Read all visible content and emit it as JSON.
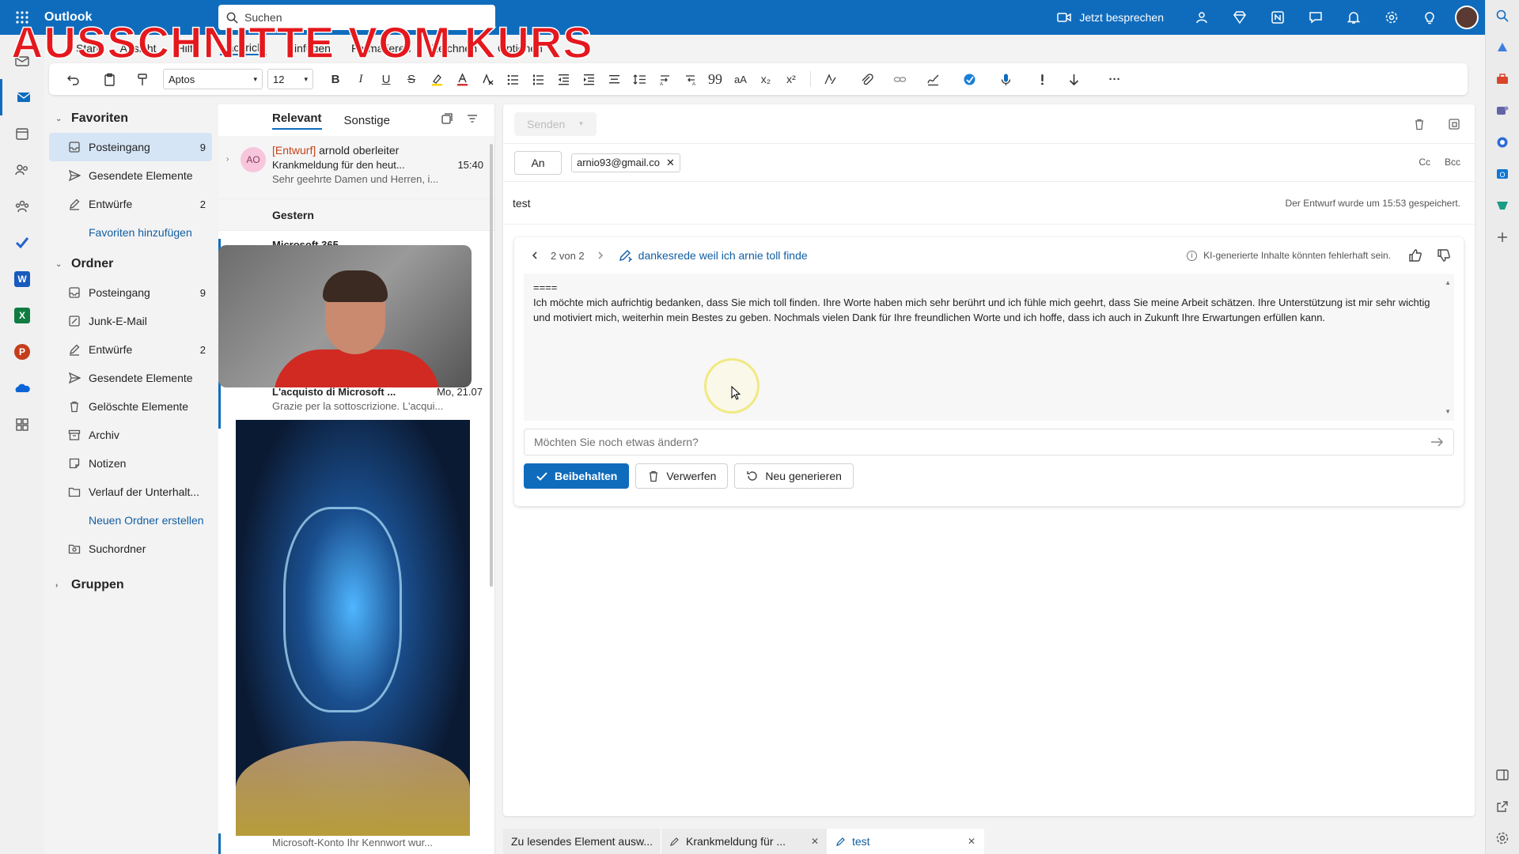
{
  "app": {
    "title": "Outlook"
  },
  "search": {
    "placeholder": "Suchen"
  },
  "topbar": {
    "meet_label": "Jetzt besprechen"
  },
  "watermark": {
    "text": "AUSSCHNITTE VOM KURS"
  },
  "ribbon": {
    "tabs": [
      "Start",
      "Ansicht",
      "Hilfe",
      "Nachricht",
      "Einfügen",
      "Formatieren",
      "Zeichnen",
      "Optionen"
    ],
    "active_tab": "Nachricht",
    "font": "Aptos",
    "font_size": "12"
  },
  "folders": {
    "favorites_label": "Favoriten",
    "favorites": [
      {
        "label": "Posteingang",
        "count": "9",
        "active": true
      },
      {
        "label": "Gesendete Elemente",
        "count": ""
      },
      {
        "label": "Entwürfe",
        "count": "2"
      }
    ],
    "add_favorite": "Favoriten hinzufügen",
    "folders_label": "Ordner",
    "folders": [
      {
        "label": "Posteingang",
        "count": "9"
      },
      {
        "label": "Junk-E-Mail",
        "count": ""
      },
      {
        "label": "Entwürfe",
        "count": "2"
      },
      {
        "label": "Gesendete Elemente",
        "count": ""
      },
      {
        "label": "Gelöschte Elemente",
        "count": ""
      },
      {
        "label": "Archiv",
        "count": ""
      },
      {
        "label": "Notizen",
        "count": ""
      },
      {
        "label": "Verlauf der Unterhalt...",
        "count": ""
      }
    ],
    "new_folder": "Neuen Ordner erstellen",
    "search_folders": "Suchordner",
    "groups_label": "Gruppen"
  },
  "message_list": {
    "tabs": [
      "Relevant",
      "Sonstige"
    ],
    "first": {
      "avatar": "AO",
      "draft_tag": "[Entwurf]",
      "sender": " arnold oberleiter",
      "subject": "Krankmeldung für den heut...",
      "time": "15:40",
      "preview": "Sehr geehrte Damen und Herren, i..."
    },
    "group_yesterday": "Gestern",
    "msft_sender": "Microsoft 365",
    "row_subject": "L'acquisto di Microsoft ...",
    "row_time": "Mo, 21.07",
    "row_preview": "Grazie per la sottoscrizione. L'acqui...",
    "last_preview": "Microsoft-Konto Ihr Kennwort wur..."
  },
  "compose": {
    "send_label": "Senden",
    "to_label": "An",
    "recipient": "arnio93@gmail.co",
    "cc": "Cc",
    "bcc": "Bcc",
    "subject": "test",
    "saved_note": "Der Entwurf wurde um 15:53 gespeichert."
  },
  "ai_card": {
    "counter": "2 von 2",
    "title": "dankesrede weil ich arnie toll finde",
    "disclaimer": "KI-generierte Inhalte könnten fehlerhaft sein.",
    "separator": "====",
    "body": "Ich möchte mich aufrichtig bedanken, dass Sie mich toll finden. Ihre Worte haben mich sehr berührt und ich fühle mich geehrt, dass Sie meine Arbeit schätzen. Ihre Unterstützung ist mir sehr wichtig und motiviert mich, weiterhin mein Bestes zu geben. Nochmals vielen Dank für Ihre freundlichen Worte und ich hoffe, dass ich auch in Zukunft Ihre Erwartungen erfüllen kann.",
    "refine_placeholder": "Möchten Sie noch etwas ändern?",
    "keep": "Beibehalten",
    "discard": "Verwerfen",
    "regenerate": "Neu generieren"
  },
  "bottom_tabs": [
    {
      "label": "Zu lesendes Element ausw...",
      "active": false,
      "closable": false
    },
    {
      "label": "Krankmeldung für ...",
      "active": false,
      "closable": true
    },
    {
      "label": "test",
      "active": true,
      "closable": true
    }
  ],
  "colors": {
    "accent": "#0f6cbd",
    "watermark": "#e4181d",
    "draft": "#c4431a"
  }
}
